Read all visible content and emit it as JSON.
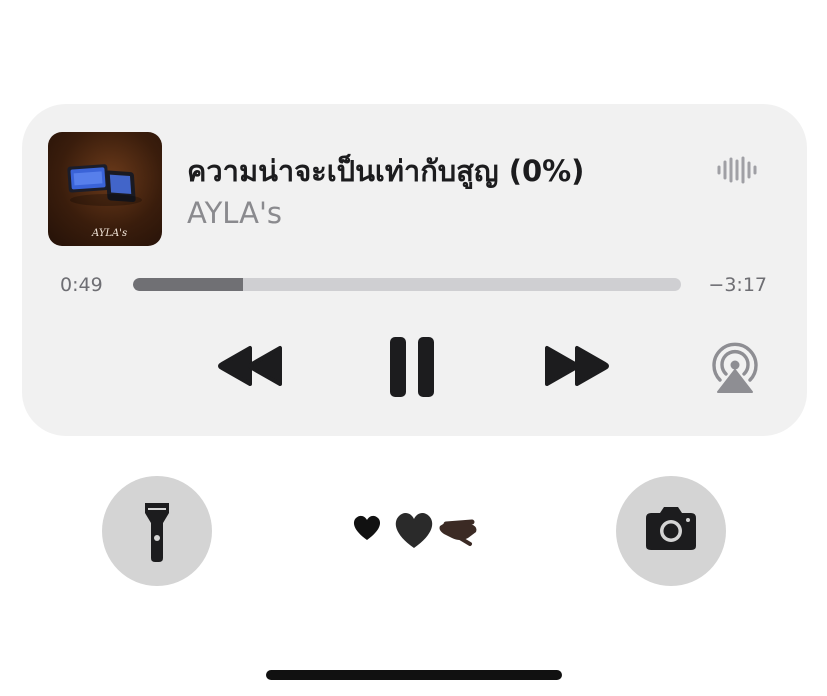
{
  "now_playing": {
    "title": "ความน่าจะเป็นเท่ากับสูญ (0%)",
    "artist": "AYLA's",
    "artwork_text": "AYLA's",
    "elapsed": "0:49",
    "remaining": "−3:17",
    "progress_fraction": 0.2
  },
  "controls": {
    "rewind_icon": "rewind-icon",
    "pause_icon": "pause-icon",
    "forward_icon": "fast-forward-icon",
    "airplay_icon": "airplay-audio-icon",
    "waveform_icon": "audio-waveform-icon"
  },
  "lock_screen": {
    "flashlight_icon": "flashlight-icon",
    "camera_icon": "camera-icon",
    "emoji_text": "🖤🫳🏿"
  },
  "colors": {
    "card_bg": "#f1f1f1",
    "progress_fill": "#707074",
    "progress_track": "#cfcfd2",
    "round_button_bg": "#d4d4d4"
  }
}
